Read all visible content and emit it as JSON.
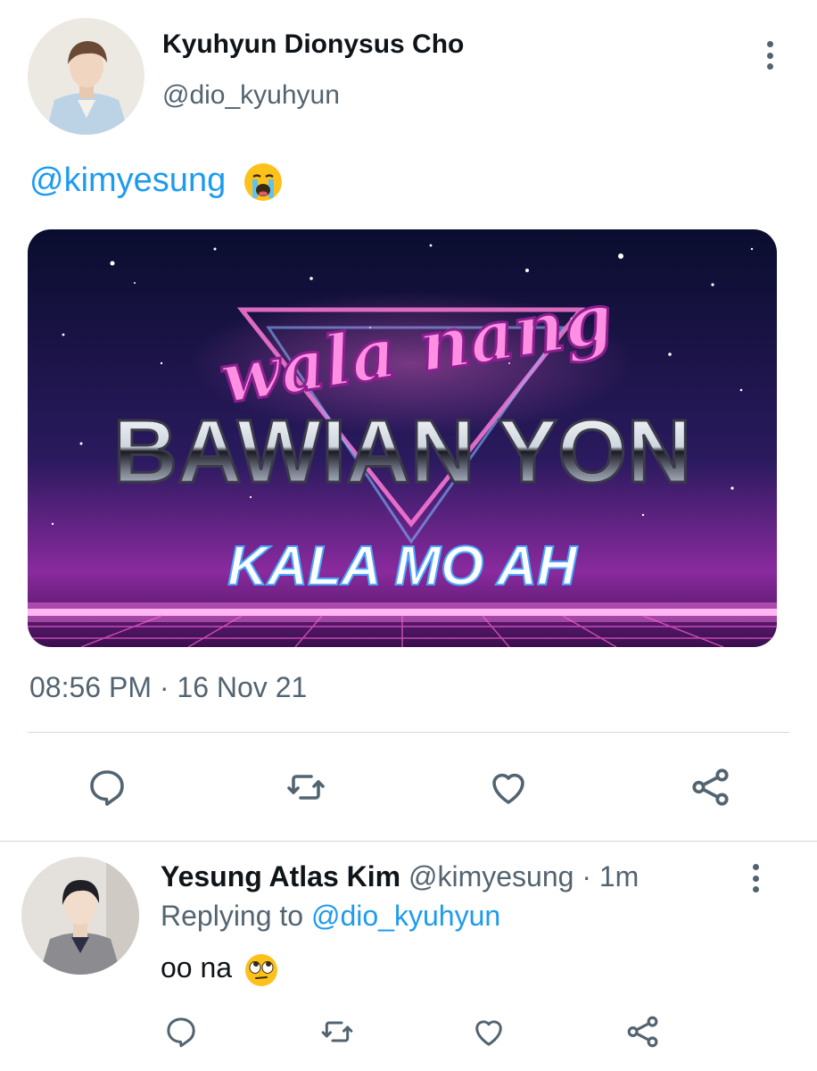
{
  "tweet": {
    "author_name": "Kyuhyun Dionysus Cho",
    "author_handle": "@dio_kyuhyun",
    "mention": "@kimyesung",
    "mention_emoji": "loudly-crying-face",
    "image": {
      "line1": "wala nang",
      "line2": "BAWIAN YON",
      "line3": "KALA MO AH"
    },
    "timestamp": "08:56 PM · 16 Nov 21",
    "actions": [
      "reply",
      "retweet",
      "like",
      "share"
    ]
  },
  "reply": {
    "author_name": "Yesung Atlas Kim",
    "author_handle": "@kimyesung",
    "time": "· 1m",
    "replying_prefix": "Replying to",
    "replying_handle": "@dio_kyuhyun",
    "text": "oo na",
    "text_emoji": "face-with-rolling-eyes",
    "actions": [
      "reply",
      "retweet",
      "like",
      "share"
    ]
  },
  "colors": {
    "accent": "#1d9bf0",
    "muted_text": "#536471",
    "divider": "#cfd9de"
  }
}
